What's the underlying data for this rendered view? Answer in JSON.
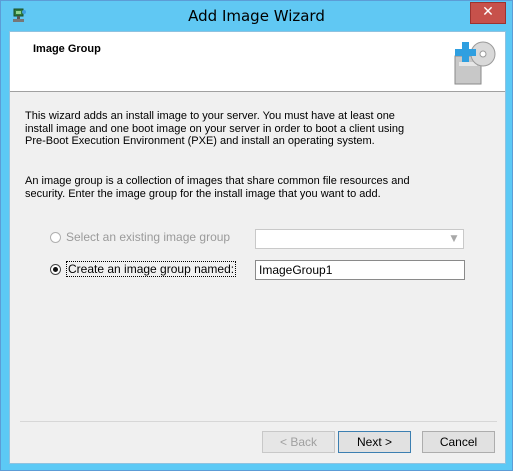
{
  "window": {
    "title": "Add Image Wizard",
    "close_glyph": "✕"
  },
  "header": {
    "title": "Image Group"
  },
  "intro": "This wizard adds an install image to your server. You must have at least one install image and one boot image on your server in order to boot a client using Pre-Boot Execution Environment (PXE) and install an operating system.",
  "description": "An image group is a collection of images that share common file resources and security. Enter the image group for the install image that you want to add.",
  "options": {
    "existing_label": "Select an existing image group",
    "create_label": "Create an image group named:",
    "selected": "create"
  },
  "existing_select": {
    "value": ""
  },
  "group_name_input": {
    "value": "ImageGroup1"
  },
  "buttons": {
    "back": "< Back",
    "next": "Next >",
    "cancel": "Cancel"
  },
  "icons": {
    "app": "wizard-app-icon",
    "header": "add-disc-image-icon",
    "dropdown": "chevron-down-icon"
  },
  "colors": {
    "titlebar": "#60c8f3",
    "close": "#c7514b",
    "header_plus": "#2f9fe0"
  }
}
